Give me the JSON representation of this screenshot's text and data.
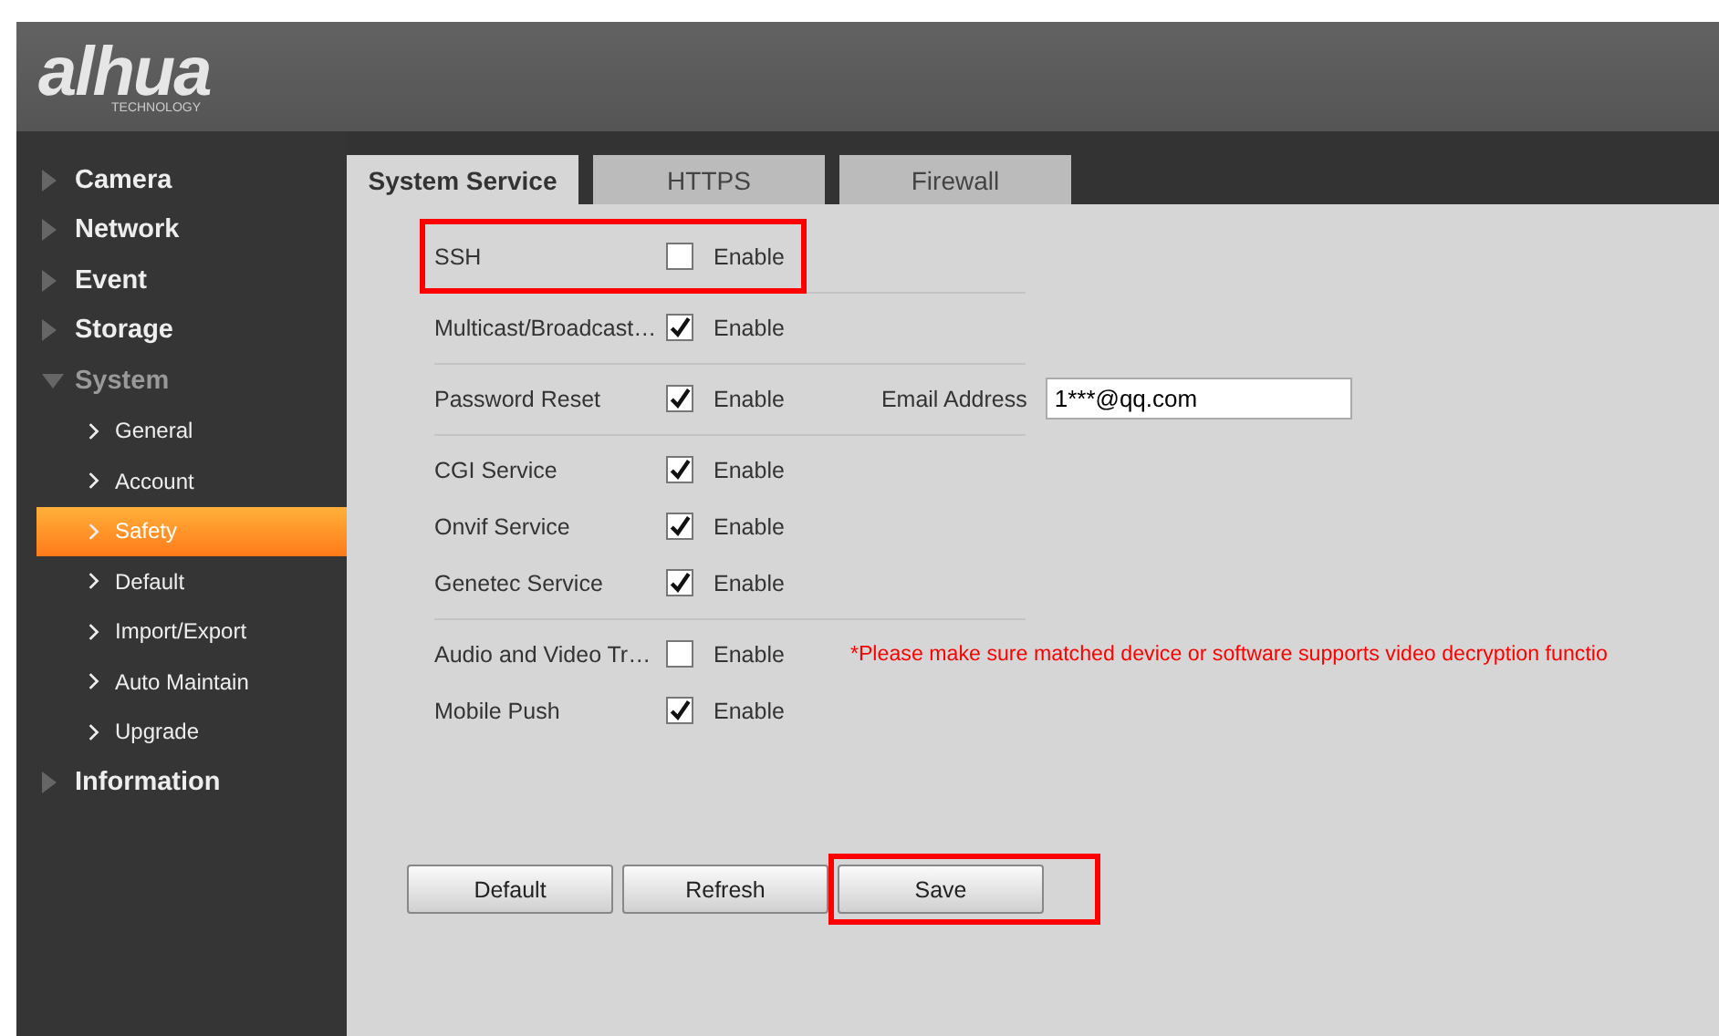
{
  "logo": {
    "wordmark": "alhua",
    "tagline": "TECHNOLOGY"
  },
  "sidebar": {
    "items": [
      {
        "label": "Camera",
        "expanded": false
      },
      {
        "label": "Network",
        "expanded": false
      },
      {
        "label": "Event",
        "expanded": false
      },
      {
        "label": "Storage",
        "expanded": false
      },
      {
        "label": "System",
        "expanded": true,
        "children": [
          {
            "label": "General",
            "selected": false
          },
          {
            "label": "Account",
            "selected": false
          },
          {
            "label": "Safety",
            "selected": true
          },
          {
            "label": "Default",
            "selected": false
          },
          {
            "label": "Import/Export",
            "selected": false
          },
          {
            "label": "Auto Maintain",
            "selected": false
          },
          {
            "label": "Upgrade",
            "selected": false
          }
        ]
      },
      {
        "label": "Information",
        "expanded": false
      }
    ]
  },
  "tabs": [
    {
      "label": "System Service",
      "selected": true
    },
    {
      "label": "HTTPS",
      "selected": false
    },
    {
      "label": "Firewall",
      "selected": false
    }
  ],
  "groups": [
    [
      {
        "label": "SSH",
        "checked": false,
        "option": "Enable",
        "highlighted": true
      }
    ],
    [
      {
        "label": "Multicast/Broadcast…",
        "checked": true,
        "option": "Enable",
        "highlighted": false
      }
    ],
    [
      {
        "label": "Password Reset",
        "checked": true,
        "option": "Enable",
        "highlighted": false,
        "field": {
          "label": "Email Address",
          "value": "1***@qq.com"
        }
      }
    ],
    [
      {
        "label": "CGI Service",
        "checked": true,
        "option": "Enable",
        "highlighted": false
      },
      {
        "label": "Onvif Service",
        "checked": true,
        "option": "Enable",
        "highlighted": false
      },
      {
        "label": "Genetec Service",
        "checked": true,
        "option": "Enable",
        "highlighted": false
      }
    ],
    [
      {
        "label": "Audio and Video Tr…",
        "checked": false,
        "option": "Enable",
        "highlighted": false,
        "note": "*Please make sure matched device or software supports video decryption functio"
      },
      {
        "label": "Mobile Push",
        "checked": true,
        "option": "Enable",
        "highlighted": false
      }
    ]
  ],
  "buttons": [
    {
      "label": "Default",
      "highlighted": false
    },
    {
      "label": "Refresh",
      "highlighted": false
    },
    {
      "label": "Save",
      "highlighted": true
    }
  ]
}
